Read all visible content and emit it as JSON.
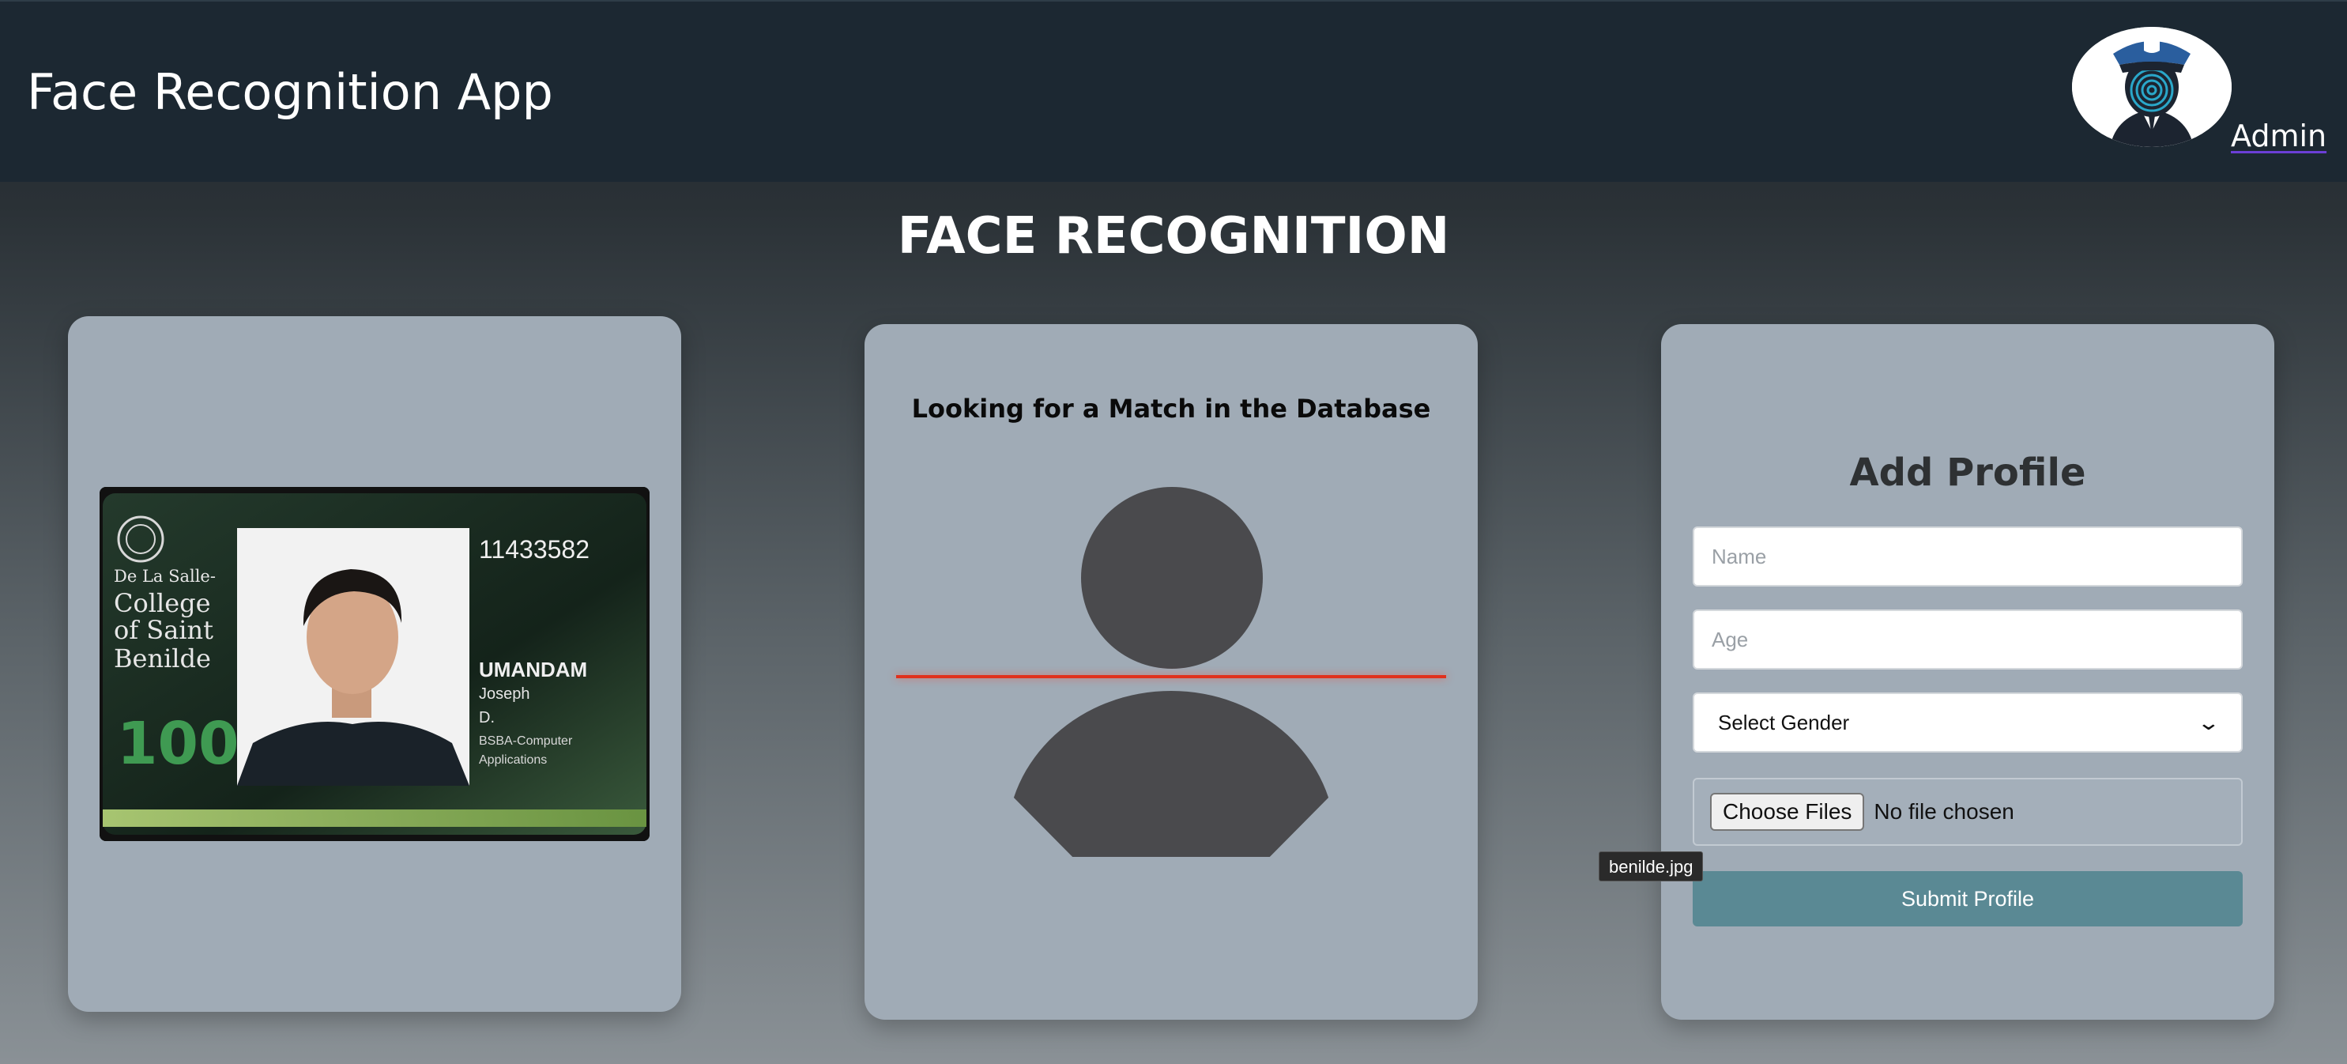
{
  "header": {
    "app_title": "Face Recognition App",
    "logo_icon": "police-officer-logo-icon",
    "admin_label": "Admin"
  },
  "main": {
    "heading": "FACE RECOGNITION"
  },
  "id_card": {
    "image_icon": "student-id-card-image",
    "id_number": "11433582",
    "school_line1": "De La Salle-",
    "school_line2": "College",
    "school_line3": "of Saint",
    "school_line4": "Benilde",
    "last_name": "UMANDAM",
    "first_name": "Joseph",
    "middle_initial": "D.",
    "program_line1": "BSBA-Computer",
    "program_line2": "Applications",
    "anniversary": "100"
  },
  "match_panel": {
    "title": "Looking for a Match in the Database",
    "avatar_icon": "user-silhouette-icon",
    "scan_color": "#e0301c"
  },
  "add_profile": {
    "title": "Add Profile",
    "name_placeholder": "Name",
    "age_placeholder": "Age",
    "gender_selected": "Select Gender",
    "file_button_label": "Choose Files",
    "file_status": "No file chosen",
    "submit_label": "Submit Profile",
    "submit_color": "#5a8994"
  },
  "tooltip": {
    "text": "benilde.jpg"
  }
}
